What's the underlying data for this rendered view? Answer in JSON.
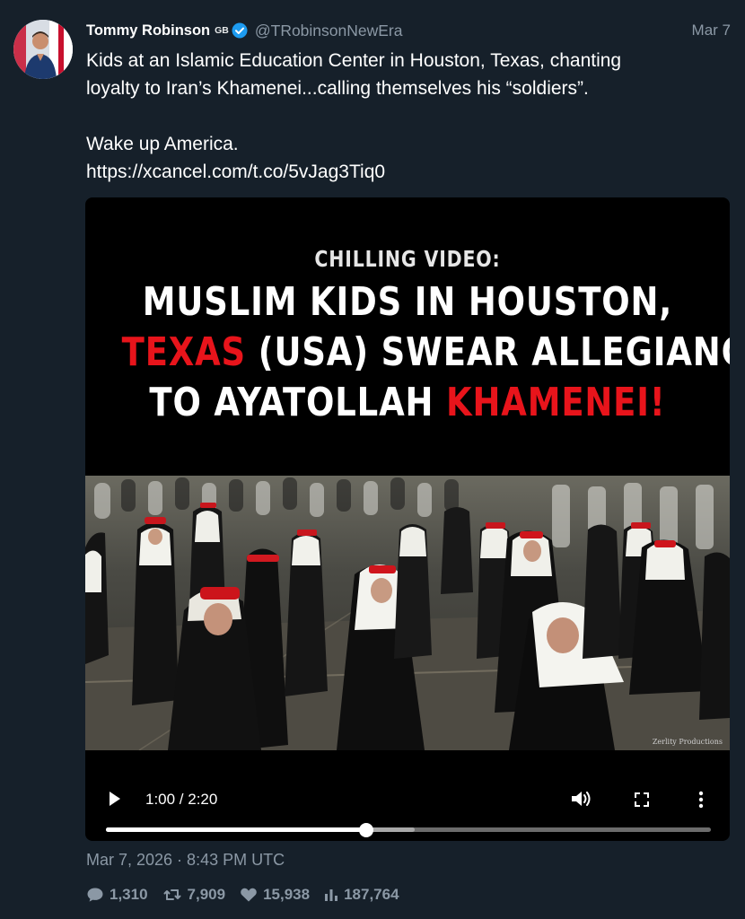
{
  "author": {
    "display_name": "Tommy Robinson",
    "flag_label": "GB",
    "handle": "@TRobinsonNewEra",
    "date_short": "Mar 7"
  },
  "tweet": {
    "line1": "Kids at an Islamic Education Center in Houston, Texas, chanting",
    "line2": "loyalty to Iran’s Khamenei...calling themselves his “soldiers”.",
    "line3": "Wake up America.",
    "link": " https://xcancel.com/t.co/5vJag3Tiq0"
  },
  "media": {
    "headline": {
      "kicker": "CHILLING VIDEO:",
      "line1": "MUSLIM KIDS IN HOUSTON,",
      "line2_red": "TEXAS",
      "line2_rest": " (USA) SWEAR ALLEGIANCE",
      "line3_rest": "TO AYATOLLAH ",
      "line3_red": "KHAMENEI!"
    },
    "watermark": "Zerlity Productions",
    "player": {
      "time": "1:00 / 2:20",
      "played_fraction": 0.43,
      "buffered_fraction": 0.51
    }
  },
  "timestamp": "Mar 7, 2026 · 8:43 PM UTC",
  "stats": {
    "replies": "1,310",
    "retweets": "7,909",
    "likes": "15,938",
    "views": "187,764"
  },
  "colors": {
    "background": "#16202a",
    "muted_text": "#8b98a5",
    "verified": "#1d9bf0",
    "headline_red": "#e8141b"
  },
  "icons": {
    "verified": "verified-badge-icon",
    "play": "play-icon",
    "volume": "volume-icon",
    "fullscreen": "fullscreen-icon",
    "more": "more-vertical-icon",
    "reply": "comment-icon",
    "retweet": "retweet-icon",
    "like": "heart-icon",
    "views": "bar-chart-icon"
  }
}
